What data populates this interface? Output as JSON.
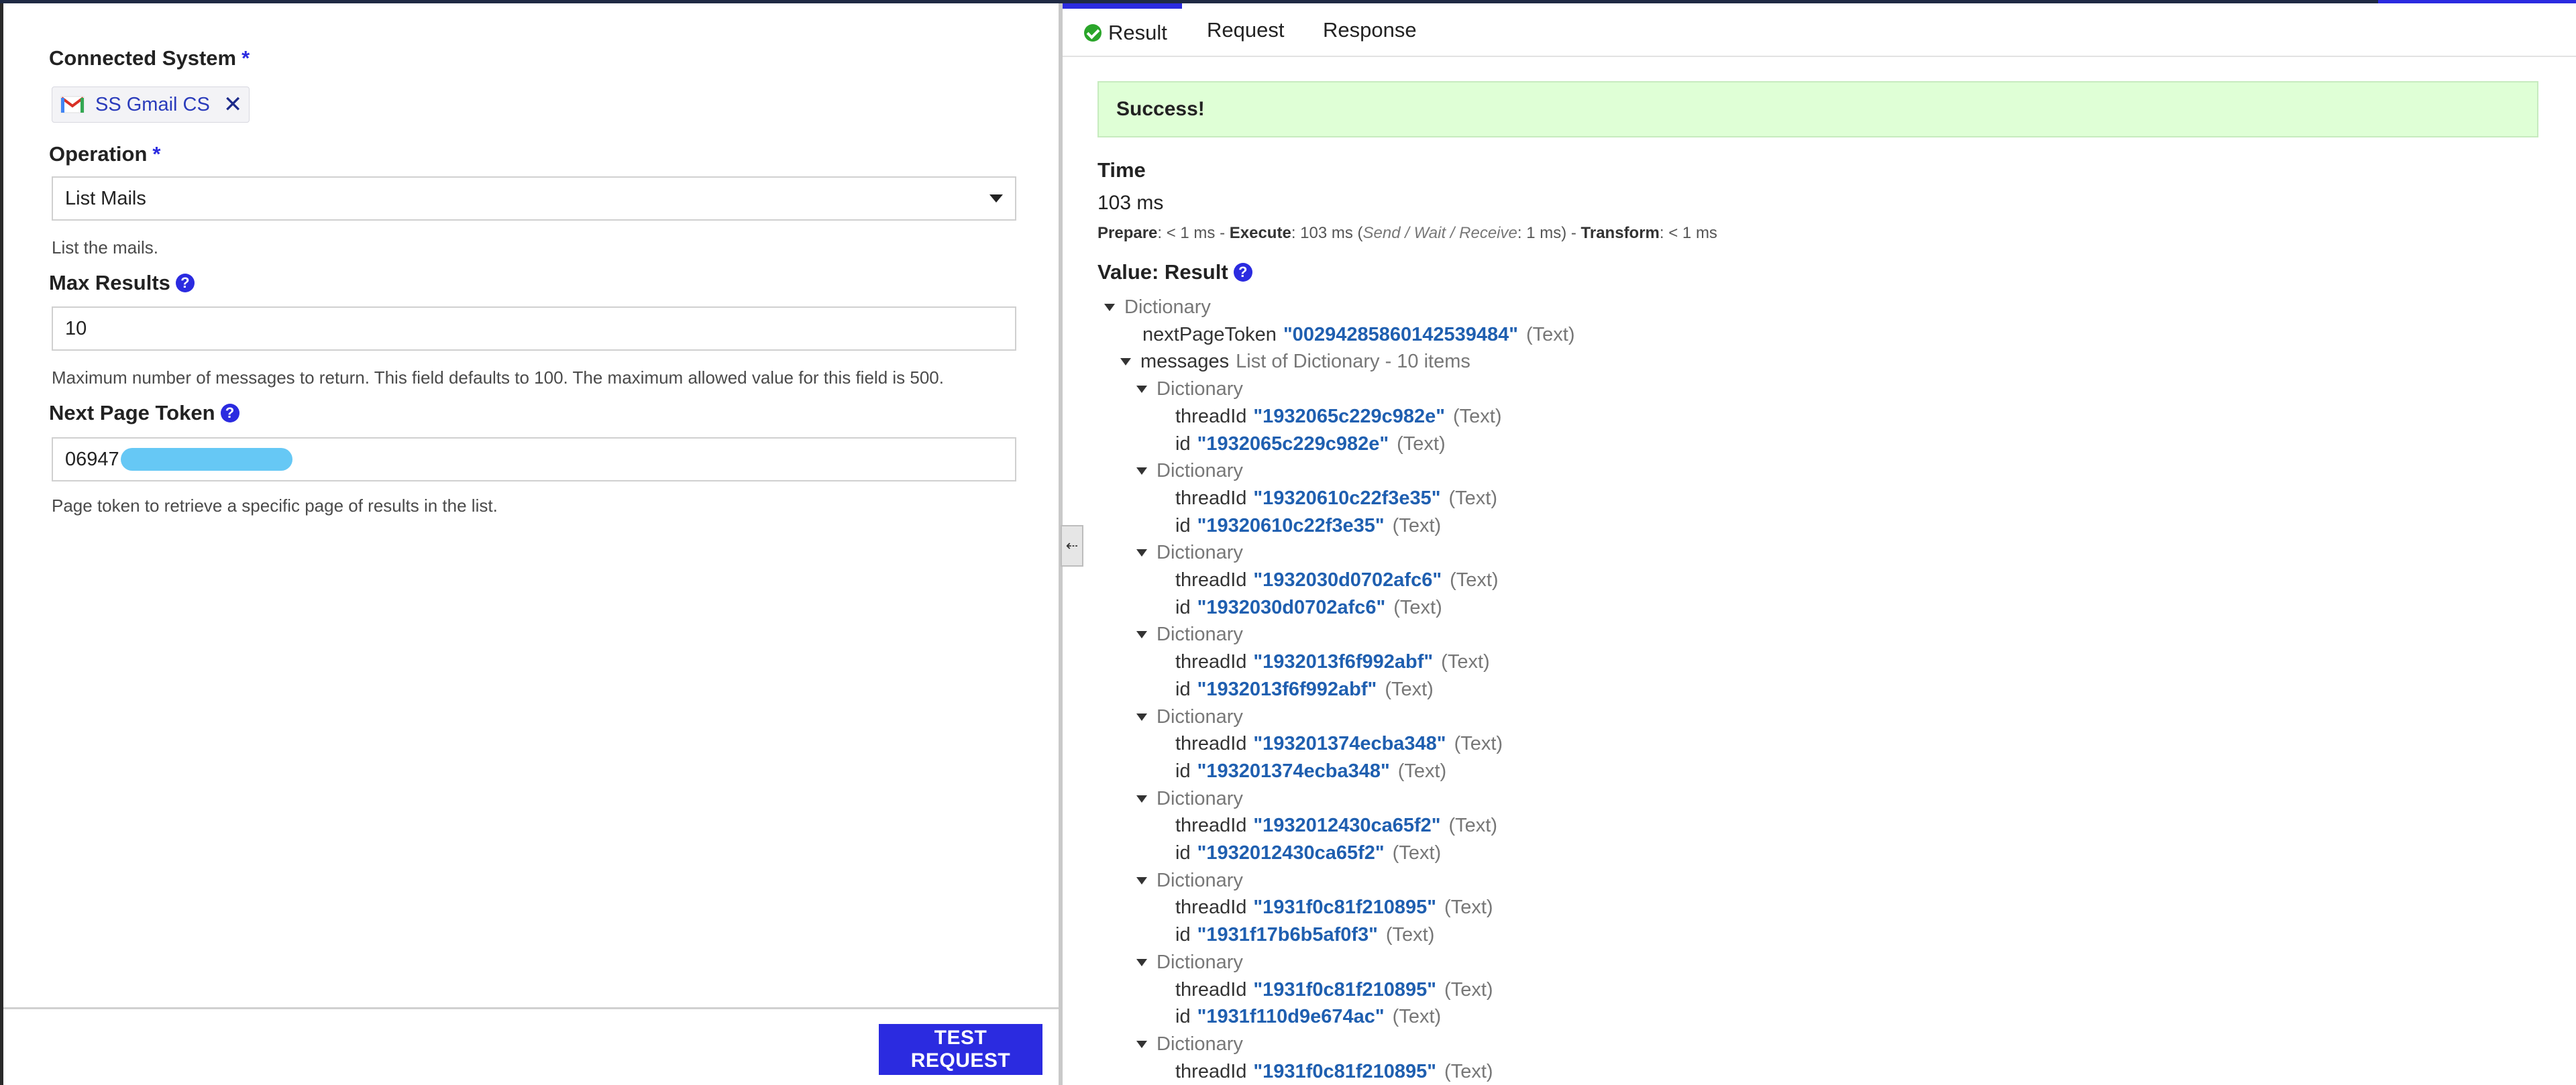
{
  "left": {
    "connected_system": {
      "label": "Connected System",
      "required_mark": "*",
      "chip_label": "SS Gmail CS",
      "chip_remove": "✕"
    },
    "operation": {
      "label": "Operation",
      "required_mark": "*",
      "value": "List Mails",
      "hint": "List the mails."
    },
    "max_results": {
      "label": "Max Results",
      "help": "?",
      "value": "10",
      "hint": "Maximum number of messages to return. This field defaults to 100. The maximum allowed value for this field is 500."
    },
    "next_page_token": {
      "label": "Next Page Token",
      "help": "?",
      "value": "06947",
      "hint": "Page token to retrieve a specific page of results in the list."
    },
    "test_button": "TEST REQUEST"
  },
  "splitter": {
    "arrow": "⇠"
  },
  "tabs": [
    {
      "label": "Result",
      "active": true
    },
    {
      "label": "Request",
      "active": false
    },
    {
      "label": "Response",
      "active": false
    }
  ],
  "result": {
    "banner": "Success!",
    "time_title": "Time",
    "time_value": "103 ms",
    "breakdown": {
      "prepare_label": "Prepare",
      "prepare_value": ": < 1 ms - ",
      "execute_label": "Execute",
      "execute_value": ": 103 ms (",
      "swr_label": "Send / Wait / Receive",
      "swr_value": ": 1 ms) - ",
      "transform_label": "Transform",
      "transform_value": ": < 1 ms"
    },
    "value_title": "Value: Result",
    "value_help": "?",
    "tree": {
      "root_type": "Dictionary",
      "next_page_token_key": "nextPageToken",
      "next_page_token_value": "\"00294285860142539484\"",
      "text_tag": "(Text)",
      "messages_key": "messages",
      "messages_type": "List of Dictionary - 10 items",
      "item_type": "Dictionary",
      "thread_key": "threadId",
      "id_key": "id",
      "messages": [
        {
          "threadId": "\"1932065c229c982e\"",
          "id": "\"1932065c229c982e\""
        },
        {
          "threadId": "\"19320610c22f3e35\"",
          "id": "\"19320610c22f3e35\""
        },
        {
          "threadId": "\"1932030d0702afc6\"",
          "id": "\"1932030d0702afc6\""
        },
        {
          "threadId": "\"1932013f6f992abf\"",
          "id": "\"1932013f6f992abf\""
        },
        {
          "threadId": "\"193201374ecba348\"",
          "id": "\"193201374ecba348\""
        },
        {
          "threadId": "\"1932012430ca65f2\"",
          "id": "\"1932012430ca65f2\""
        },
        {
          "threadId": "\"1931f0c81f210895\"",
          "id": "\"1931f17b6b5af0f3\""
        },
        {
          "threadId": "\"1931f0c81f210895\"",
          "id": "\"1931f110d9e674ac\""
        },
        {
          "threadId": "\"1931f0c81f210895\""
        }
      ]
    }
  }
}
